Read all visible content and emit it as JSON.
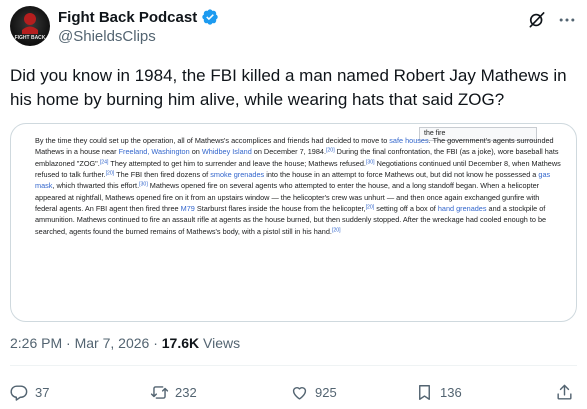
{
  "author": {
    "display_name": "Fight Back Podcast",
    "handle": "@ShieldsClips",
    "avatar_text": "FIGHT BACK",
    "verified": true
  },
  "tweet": {
    "text": "Did you know in 1984, the FBI killed a man named Robert Jay Mathews in his home by burning him alive, while wearing hats that said ZOG?"
  },
  "media": {
    "tag_label": "the fire",
    "p": [
      {
        "t": "By the time they could set up the operation, all of Mathews's accomplices and friends had decided to move to "
      },
      {
        "l": "safe houses"
      },
      {
        "t": ". The government's agents surrounded Mathews in a house near "
      },
      {
        "l": "Freeland, Washington"
      },
      {
        "t": " on "
      },
      {
        "l": "Whidbey Island"
      },
      {
        "t": " on December 7, 1984."
      },
      {
        "s": "[20]"
      },
      {
        "t": " During the final confrontation, the FBI (as a joke), wore baseball hats emblazoned \"ZOG\"."
      },
      {
        "s": "[24]"
      },
      {
        "t": " They attempted to get him to surrender and leave the house; Mathews refused."
      },
      {
        "s": "[30]"
      },
      {
        "t": " Negotiations continued until December 8, when Mathews refused to talk further."
      },
      {
        "s": "[20]"
      },
      {
        "t": " The FBI then fired dozens of "
      },
      {
        "l": "smoke grenades"
      },
      {
        "t": " into the house in an attempt to force Mathews out, but did not know he possessed a "
      },
      {
        "l": "gas mask"
      },
      {
        "t": ", which thwarted this effort."
      },
      {
        "s": "[30]"
      },
      {
        "t": " Mathews opened fire on several agents who attempted to enter the house, and a long standoff began. When a helicopter appeared at nightfall, Mathews opened fire on it from an upstairs window — the helicopter's crew was unhurt — and then once again exchanged gunfire with federal agents. An FBI agent then fired three "
      },
      {
        "l": "M79"
      },
      {
        "t": " Starburst flares inside the house from the helicopter,"
      },
      {
        "s": "[20]"
      },
      {
        "t": " setting off a box of "
      },
      {
        "l": "hand grenades"
      },
      {
        "t": " and a stockpile of ammunition. Mathews continued to fire an assault rifle at agents as the house burned, but then suddenly stopped. After the wreckage had cooled enough to be searched, agents found the burned remains of Mathews's body, with a pistol still in his hand."
      },
      {
        "s": "[20]"
      }
    ]
  },
  "meta": {
    "time": "2:26 PM",
    "sep": "·",
    "date": "Mar 7, 2026",
    "views_count": "17.6K",
    "views_label": "Views"
  },
  "actions": {
    "replies": "37",
    "reposts": "232",
    "likes": "925",
    "bookmarks": "136"
  },
  "colors": {
    "link": "#3366cc",
    "verified": "#1d9bf0",
    "secondary_text": "#536471"
  },
  "icons": {
    "header": [
      "grok-icon",
      "more-icon"
    ],
    "actions": [
      "reply-icon",
      "repost-icon",
      "like-icon",
      "bookmark-icon",
      "share-icon"
    ]
  }
}
